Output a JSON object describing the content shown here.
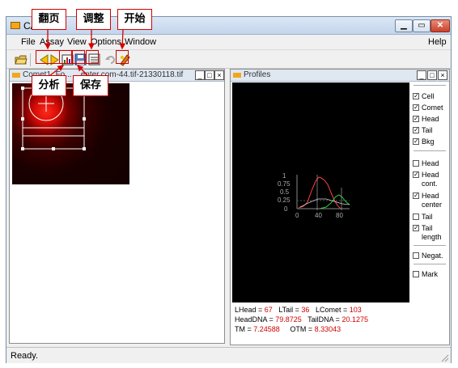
{
  "window": {
    "title": "CA"
  },
  "menu": {
    "file": "File",
    "assay": "Assay",
    "view": "View",
    "options": "Options",
    "window": "Window",
    "help": "Help"
  },
  "annotations": {
    "page_turn": "翻页",
    "adjust": "调整",
    "start": "开始",
    "analyze": "分析",
    "save": "保存"
  },
  "image_window": {
    "title": "Comet1_Fo... ...enter.com-44.tif-21330118.tif"
  },
  "profiles_window": {
    "title": "Profiles",
    "plot_y_ticks": [
      "1",
      "0.75",
      "0.5",
      "0.25",
      "0"
    ],
    "plot_x_ticks": [
      "0",
      "40",
      "80"
    ]
  },
  "metrics": {
    "lhead_label": "LHead = ",
    "lhead_value": "67",
    "ltail_label": "LTail = ",
    "ltail_value": "36",
    "lcomet_label": "LComet = ",
    "lcomet_value": "103",
    "headdna_label": "HeadDNA = ",
    "headdna_value": "79.8725",
    "taildna_label": "TailDNA = ",
    "taildna_value": "20.1275",
    "tm_label": "TM = ",
    "tm_value": "7.24588",
    "otm_label": "OTM = ",
    "otm_value": "8.33043"
  },
  "options": {
    "cell": {
      "label": "Cell",
      "checked": true
    },
    "comet": {
      "label": "Comet",
      "checked": true
    },
    "head": {
      "label": "Head",
      "checked": true
    },
    "tail": {
      "label": "Tail",
      "checked": true
    },
    "bkg": {
      "label": "Bkg",
      "checked": true
    },
    "head2": {
      "label": "Head",
      "checked": false
    },
    "head_cont": {
      "label_1": "Head",
      "label_2": "cont.",
      "checked": true
    },
    "head_center": {
      "label_1": "Head",
      "label_2": "center",
      "checked": true
    },
    "tail2": {
      "label": "Tail",
      "checked": false
    },
    "tail_length": {
      "label_1": "Tail",
      "label_2": "length",
      "checked": true
    },
    "negat": {
      "label": "Negat.",
      "checked": false
    },
    "mark": {
      "label": "Mark",
      "checked": false
    }
  },
  "status": {
    "text": "Ready."
  },
  "colors": {
    "annotation_red": "#d40000",
    "profile_bg": "#000000",
    "head_profile": "#ff4040",
    "tail_profile": "#2ecc40",
    "metric_value": "#d00000"
  },
  "icons": {
    "open": "open-folder-icon",
    "prev": "prev-triangle-icon",
    "next": "next-triangle-icon",
    "analyze": "analyze-icon",
    "save": "save-icon",
    "adjust": "adjust-icon",
    "undo": "undo-icon",
    "start": "start-icon"
  }
}
